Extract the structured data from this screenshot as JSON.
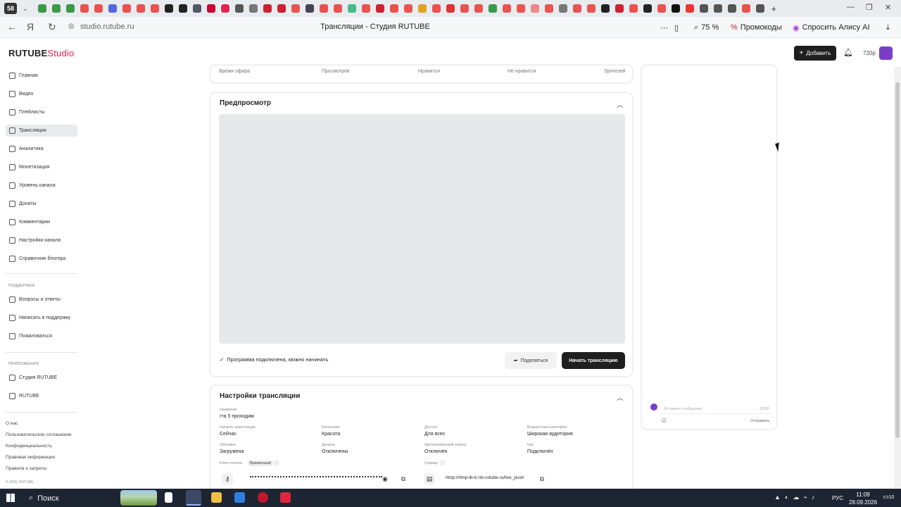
{
  "browser": {
    "tab_count": "58",
    "url": "studio.rutube.ru",
    "title": "Трансляции - Студия RUTUBE",
    "zoom": "75 %",
    "promo_label": "Промокоды",
    "alice_label": "Спросить Алису AI"
  },
  "header": {
    "logo_main": "RUTUBE",
    "logo_studio": "Studio",
    "add_label": "Добавить",
    "quality": "720p"
  },
  "sidebar": {
    "items": [
      {
        "label": "Главная"
      },
      {
        "label": "Видео"
      },
      {
        "label": "Плейлисты"
      },
      {
        "label": "Трансляции"
      },
      {
        "label": "Аналитика"
      },
      {
        "label": "Монетизация"
      },
      {
        "label": "Уровень канала"
      },
      {
        "label": "Донаты"
      },
      {
        "label": "Комментарии"
      },
      {
        "label": "Настройки канала"
      },
      {
        "label": "Справочник блогера"
      }
    ],
    "support_head": "ПОДДЕРЖКА",
    "support": [
      {
        "label": "Вопросы и ответы"
      },
      {
        "label": "Написать в поддержку"
      },
      {
        "label": "Пожаловаться"
      }
    ],
    "apps_head": "ПРИЛОЖЕНИЯ",
    "apps": [
      {
        "label": "Студия RUTUBE"
      },
      {
        "label": "RUTUBE"
      }
    ],
    "footer": [
      {
        "label": "О нас"
      },
      {
        "label": "Пользовательское соглашение"
      },
      {
        "label": "Конфиденциальность"
      },
      {
        "label": "Правовая информация"
      },
      {
        "label": "Правила и запреты"
      }
    ],
    "copyright": "© 2026, RUTUBE"
  },
  "stats": {
    "airtime": "Время эфира",
    "views": "Просмотров",
    "likes": "Нравится",
    "dislikes": "Не нравится",
    "viewers": "Зрителей"
  },
  "preview": {
    "title": "Предпросмотр",
    "status": "Программа подключена, можно начинать",
    "share_label": "Поделиться",
    "start_label": "Начать трансляцию"
  },
  "settings": {
    "title": "Настройки трансляции",
    "name_label": "Название",
    "name_value": "гта 5 проходим",
    "start_label": "Начало трансляции",
    "start_value": "Сейчас",
    "category_label": "Категория",
    "category_value": "Красота",
    "access_label": "Доступ",
    "access_value": "Для всех",
    "age_label": "Возрастная категория",
    "age_value": "Широкая аудитория",
    "cover_label": "Обложка",
    "cover_value": "Загружена",
    "donations_label": "Донаты",
    "donations_value": "Отключены",
    "autostart_label": "Автоматический запуск",
    "autostart_value": "Отключён",
    "chat_label": "Чат",
    "chat_value": "Подключён",
    "key_label": "Ключ потока",
    "key_badge": "Временный",
    "server_label": "Сервер",
    "server_value": "rtmp://rtmp-lb-b.ntv.rutube.ru/live_push"
  },
  "chat": {
    "placeholder": "Оставить сообщение...",
    "counter": "0/200",
    "send_label": "Отправить"
  },
  "taskbar": {
    "search_label": "Поиск",
    "lang": "РУС",
    "time": "11:09",
    "date": "28.09.2026",
    "notif_count": "10"
  },
  "colors": {
    "brand_red": "#e8234f",
    "dark_button": "#1f1f1f",
    "avatar_purple": "#7a3dc8"
  }
}
